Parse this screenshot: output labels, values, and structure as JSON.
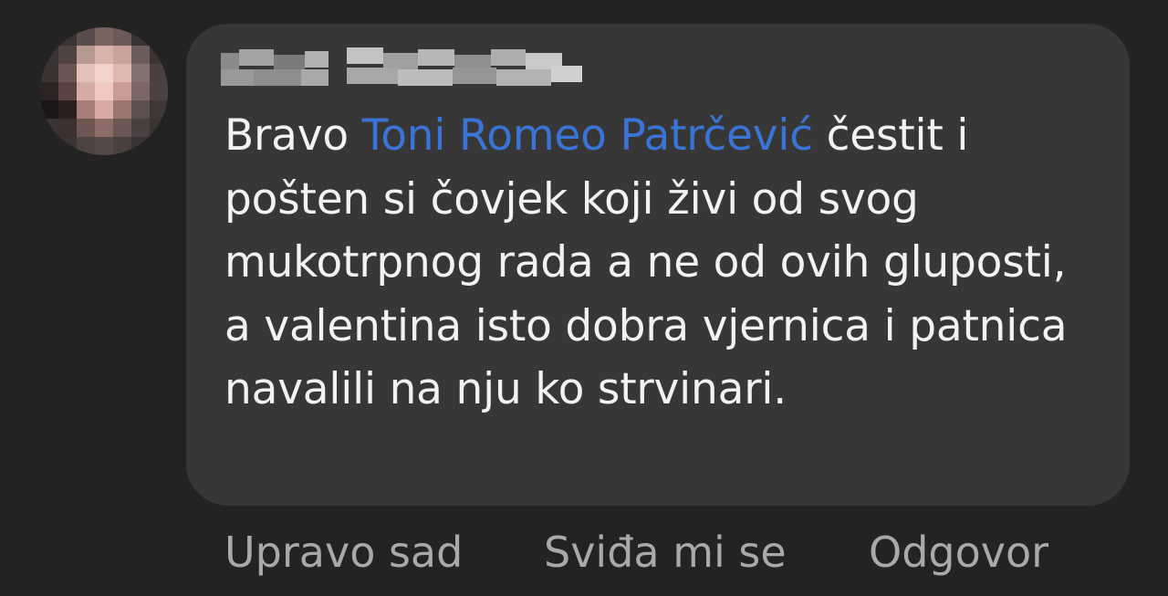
{
  "comment": {
    "author_name_redacted": true,
    "text_before_mention": "Bravo ",
    "mention": "Toni Romeo Patrčević",
    "text_after_mention": " čestit i pošten si čovjek koji živi od svog mukotrpnog rada a ne od ovih gluposti, a valentina isto dobra vjernica i patnica navalili na nju ko strvinari."
  },
  "actions": {
    "timestamp": "Upravo sad",
    "like_label": "Sviđa mi se",
    "reply_label": "Odgovor"
  },
  "colors": {
    "background": "#232323",
    "bubble": "#373737",
    "text": "#f2f2f2",
    "mention": "#3a74d6",
    "meta_text": "#a9a9a9"
  }
}
